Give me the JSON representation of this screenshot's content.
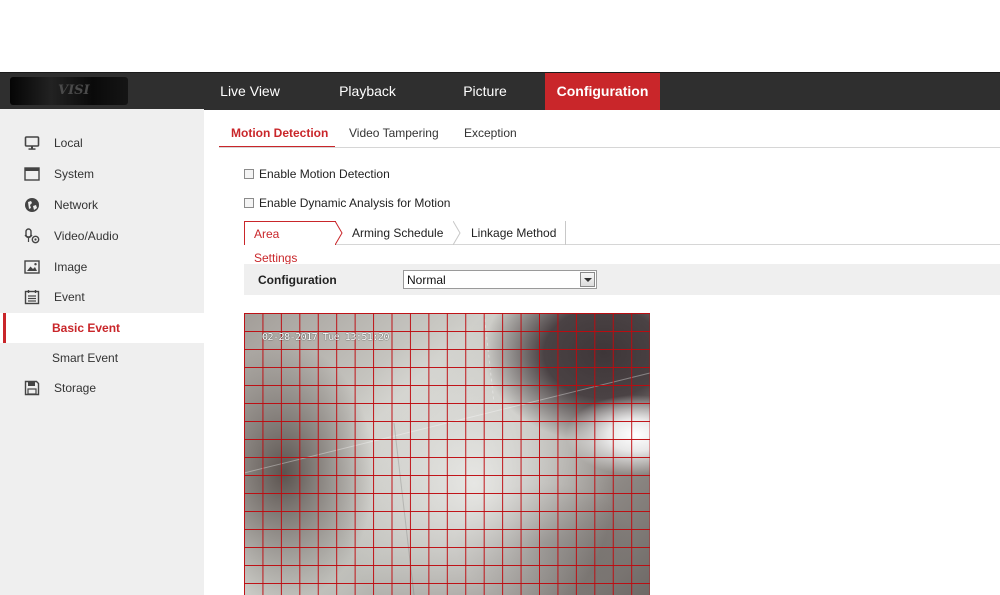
{
  "header": {
    "logo_text": "VISI",
    "nav": [
      {
        "label": "Live View"
      },
      {
        "label": "Playback"
      },
      {
        "label": "Picture"
      },
      {
        "label": "Configuration",
        "active": true
      }
    ],
    "accent_color": "#c9262a"
  },
  "sidebar": {
    "items": [
      {
        "label": "Local",
        "icon": "monitor-icon"
      },
      {
        "label": "System",
        "icon": "window-icon"
      },
      {
        "label": "Network",
        "icon": "globe-icon"
      },
      {
        "label": "Video/Audio",
        "icon": "microphone-camera-icon"
      },
      {
        "label": "Image",
        "icon": "image-icon"
      },
      {
        "label": "Event",
        "icon": "calendar-icon"
      }
    ],
    "sub_items": [
      {
        "label": "Basic Event",
        "active": true
      },
      {
        "label": "Smart Event"
      }
    ],
    "storage": {
      "label": "Storage",
      "icon": "floppy-disk-icon"
    }
  },
  "tabs": [
    {
      "label": "Motion Detection",
      "active": true
    },
    {
      "label": "Video Tampering"
    },
    {
      "label": "Exception"
    }
  ],
  "options": {
    "enable_motion": {
      "label": "Enable Motion Detection",
      "checked": false
    },
    "enable_dynamic": {
      "label": "Enable Dynamic Analysis for Motion",
      "checked": false
    }
  },
  "subtabs": [
    {
      "label": "Area Settings",
      "active": true
    },
    {
      "label": "Arming Schedule"
    },
    {
      "label": "Linkage Method"
    }
  ],
  "configuration": {
    "label": "Configuration",
    "value": "Normal"
  },
  "video": {
    "osd_text": "02-28-2017 Tue 13:51:20",
    "grid_color": "#be0a0f"
  }
}
